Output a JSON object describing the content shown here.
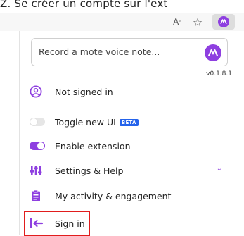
{
  "page": {
    "top_banner": "Z. Se créer un compte sur l'ext"
  },
  "browser": {
    "read_aloud_icon": "read-aloud-icon",
    "favorites_icon": "favorite-star-icon",
    "extension_icon": "mote-extension-icon"
  },
  "popup": {
    "record_placeholder": "Record a mote voice note...",
    "version": "v0.1.8.1",
    "account_status": "Not signed in",
    "toggle_new_ui_label": "Toggle new UI",
    "beta_badge": "BETA",
    "enable_extension_label": "Enable extension",
    "settings_label": "Settings & Help",
    "activity_label": "My activity & engagement",
    "signin_label": "Sign in"
  },
  "state": {
    "new_ui_enabled": false,
    "extension_enabled": true
  },
  "colors": {
    "accent": "#8e3fe0",
    "beta": "#2563eb",
    "highlight": "#e11d1d"
  }
}
